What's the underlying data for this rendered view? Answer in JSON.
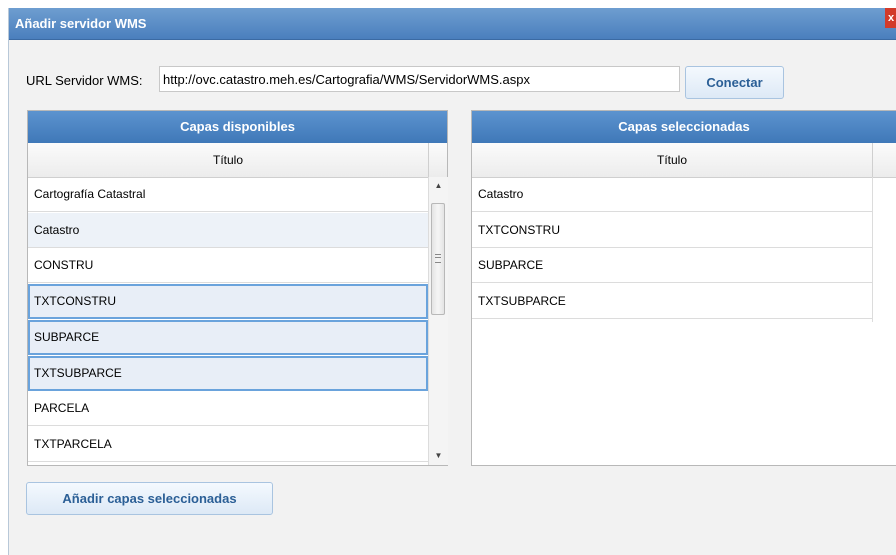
{
  "window": {
    "title": "Añadir servidor WMS",
    "close_glyph": "x"
  },
  "url": {
    "label": "URL Servidor WMS:",
    "value": "http://ovc.catastro.meh.es/Cartografia/WMS/ServidorWMS.aspx"
  },
  "connect_button": "Conectar",
  "available": {
    "header": "Capas disponibles",
    "column": "Título",
    "rows": [
      "Cartografía Catastral",
      "Catastro",
      "CONSTRU",
      "TXTCONSTRU",
      "SUBPARCE",
      "TXTSUBPARCE",
      "PARCELA",
      "TXTPARCELA"
    ],
    "selected_rows": [
      "TXTCONSTRU",
      "SUBPARCE",
      "TXTSUBPARCE"
    ]
  },
  "selected": {
    "header": "Capas seleccionadas",
    "column": "Título",
    "rows": [
      "Catastro",
      "TXTCONSTRU",
      "SUBPARCE",
      "TXTSUBPARCE"
    ]
  },
  "add_button": "Añadir capas seleccionadas",
  "colors": {
    "titlebar": "#4a7fbd",
    "panel_header": "#3f78b8",
    "button_text": "#2b5f96",
    "selection_border": "#6aa3dc",
    "close": "#d23a2a"
  }
}
